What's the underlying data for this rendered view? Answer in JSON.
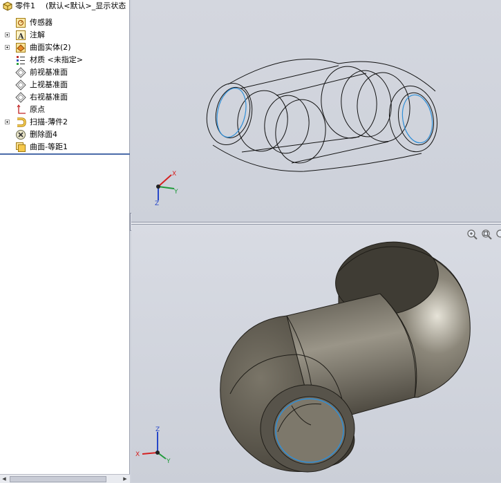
{
  "feature_tree": {
    "root": {
      "label": "零件1",
      "config": "(默认<默认>_显示状态"
    },
    "items": [
      {
        "label": "传感器",
        "icon": "sensor-icon",
        "expandable": false
      },
      {
        "label": "注解",
        "icon": "annotation-icon",
        "expandable": true
      },
      {
        "label": "曲面实体(2)",
        "icon": "surface-body-icon",
        "expandable": true
      },
      {
        "label": "材质 <未指定>",
        "icon": "material-icon",
        "expandable": false
      },
      {
        "label": "前视基准面",
        "icon": "plane-icon",
        "expandable": false
      },
      {
        "label": "上视基准面",
        "icon": "plane-icon",
        "expandable": false
      },
      {
        "label": "右视基准面",
        "icon": "plane-icon",
        "expandable": false
      },
      {
        "label": "原点",
        "icon": "origin-icon",
        "expandable": false
      },
      {
        "label": "扫描-薄件2",
        "icon": "sweep-thin-icon",
        "expandable": true
      },
      {
        "label": "删除面4",
        "icon": "delete-face-icon",
        "expandable": false
      },
      {
        "label": "曲面-等距1",
        "icon": "offset-surface-icon",
        "expandable": false
      }
    ]
  },
  "viewport_top": {
    "mode": "wireframe",
    "triad": {
      "x": "X",
      "y": "Y",
      "z": "Z"
    }
  },
  "viewport_bottom": {
    "mode": "shaded",
    "triad": {
      "x": "X",
      "y": "Y",
      "z": "Z"
    },
    "tools": [
      "zoom-to-fit-icon",
      "zoom-area-icon"
    ]
  },
  "colors": {
    "wire": "#111111",
    "edge_highlight": "#2f8fd8",
    "body": "#6b675c",
    "axis_x": "#d42020",
    "axis_y": "#1f9a3a",
    "axis_z": "#2646c8"
  }
}
